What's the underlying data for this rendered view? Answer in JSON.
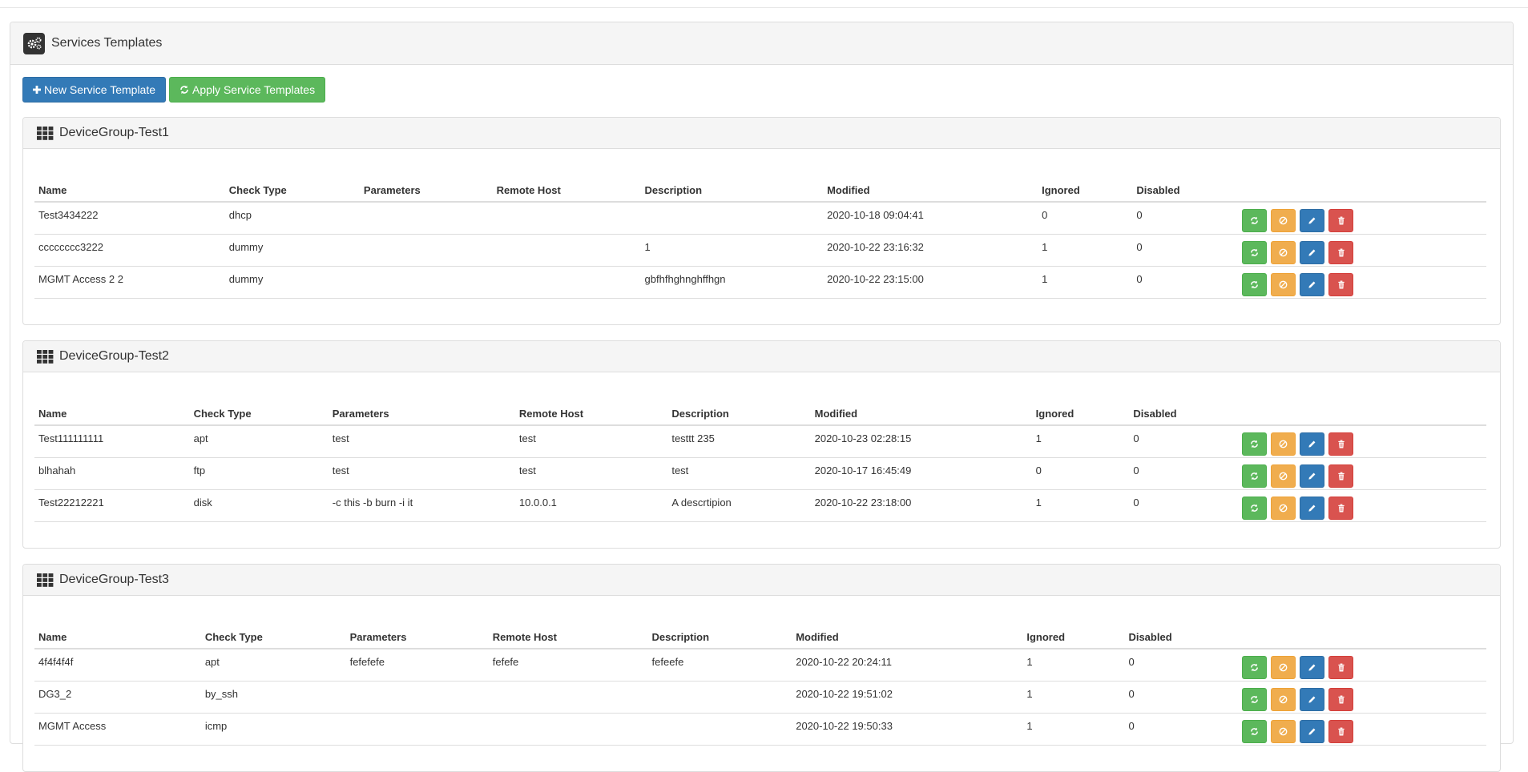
{
  "page": {
    "title": "Services Templates",
    "new_button": "New Service Template",
    "apply_button": "Apply Service Templates"
  },
  "colors": {
    "primary": "#337ab7",
    "success": "#5cb85c",
    "warning": "#f0ad4e",
    "danger": "#d9534f"
  },
  "icons": {
    "header": "gears-icon",
    "group": "grid-icon",
    "row_actions": [
      "refresh-icon",
      "ban-icon",
      "pencil-icon",
      "trash-icon"
    ]
  },
  "columns": [
    "Name",
    "Check Type",
    "Parameters",
    "Remote Host",
    "Description",
    "Modified",
    "Ignored",
    "Disabled"
  ],
  "groups": [
    {
      "title": "DeviceGroup-Test1",
      "rows": [
        [
          "Test3434222",
          "dhcp",
          "",
          "",
          "",
          "2020-10-18 09:04:41",
          "0",
          "0"
        ],
        [
          "cccccccc3222",
          "dummy",
          "",
          "",
          "1",
          "2020-10-22 23:16:32",
          "1",
          "0"
        ],
        [
          "MGMT Access 2 2",
          "dummy",
          "",
          "",
          "gbfhfhghnghffhgn",
          "2020-10-22 23:15:00",
          "1",
          "0"
        ]
      ]
    },
    {
      "title": "DeviceGroup-Test2",
      "rows": [
        [
          "Test111111111",
          "apt",
          "test",
          "test",
          "testtt 235",
          "2020-10-23 02:28:15",
          "1",
          "0"
        ],
        [
          "blhahah",
          "ftp",
          "test",
          "test",
          "test",
          "2020-10-17 16:45:49",
          "0",
          "0"
        ],
        [
          "Test22212221",
          "disk",
          "-c this -b burn -i it",
          "10.0.0.1",
          "A descrtipion",
          "2020-10-22 23:18:00",
          "1",
          "0"
        ]
      ]
    },
    {
      "title": "DeviceGroup-Test3",
      "rows": [
        [
          "4f4f4f4f",
          "apt",
          "fefefefe",
          "fefefe",
          "fefeefe",
          "2020-10-22 20:24:11",
          "1",
          "0"
        ],
        [
          "DG3_2",
          "by_ssh",
          "",
          "",
          "",
          "2020-10-22 19:51:02",
          "1",
          "0"
        ],
        [
          "MGMT Access",
          "icmp",
          "",
          "",
          "",
          "2020-10-22 19:50:33",
          "1",
          "0"
        ]
      ]
    }
  ]
}
